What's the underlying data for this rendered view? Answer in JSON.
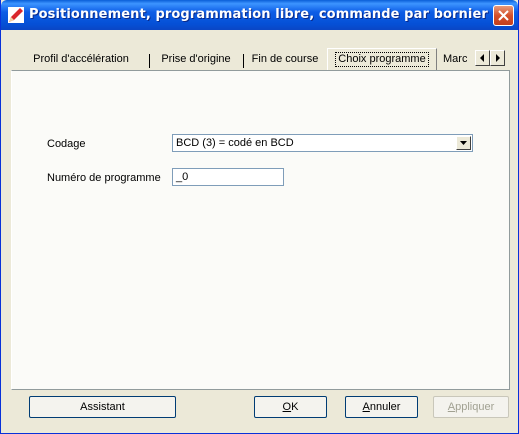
{
  "window": {
    "title": "Positionnement, programmation libre, commande par bornier"
  },
  "tabs": [
    {
      "label": "Profil d'accélération"
    },
    {
      "label": "Prise d'origine"
    },
    {
      "label": "Fin de course"
    },
    {
      "label": "Choix programme"
    },
    {
      "label": "Marc"
    }
  ],
  "active_tab": "Choix programme",
  "form": {
    "codage_label": "Codage",
    "codage_value": "BCD (3) = codé en BCD",
    "program_label": "Numéro de programme",
    "program_value": "_0"
  },
  "buttons": {
    "assistant": "Assistant",
    "ok_u": "O",
    "ok_rest": "K",
    "annuler_u": "A",
    "annuler_rest": "nnuler",
    "appliquer_u": "A",
    "appliquer_rest": "ppliquer"
  },
  "icons": {
    "app": "pencil-icon",
    "close": "close-icon",
    "scroll_left": "left-arrow-icon",
    "scroll_right": "right-arrow-icon",
    "dropdown": "dropdown-arrow-icon"
  }
}
